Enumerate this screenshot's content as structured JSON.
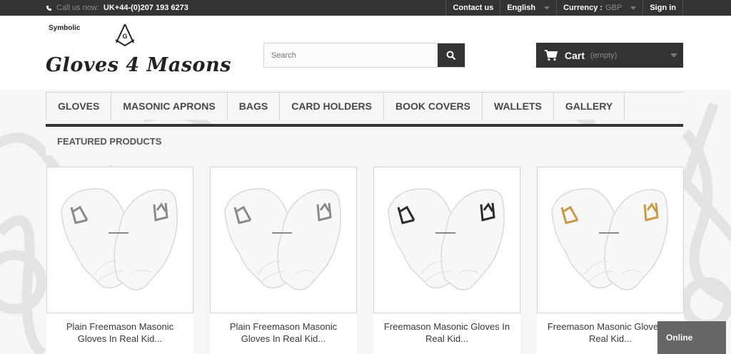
{
  "topbar": {
    "call_label": "Call us now:",
    "phone": "UK+44-(0)207 193 6273",
    "contact": "Contact us",
    "language": "English",
    "currency_label": "Currency :",
    "currency_value": "GBP",
    "signin": "Sign in"
  },
  "logo": {
    "subtitle": "Symbolic",
    "name": "Gloves 4 Masons"
  },
  "search": {
    "placeholder": "Search"
  },
  "cart": {
    "label": "Cart",
    "status": "(empty)"
  },
  "menu": {
    "items": [
      "GLOVES",
      "MASONIC APRONS",
      "BAGS",
      "CARD HOLDERS",
      "BOOK COVERS",
      "WALLETS",
      "GALLERY"
    ]
  },
  "featured": {
    "heading": "FEATURED PRODUCTS"
  },
  "products": [
    {
      "title": "Plain Freemason Masonic Gloves In Real Kid...",
      "emblem_color": "#8a8a8a"
    },
    {
      "title": "Plain Freemason Masonic Gloves In Real Kid...",
      "emblem_color": "#8a8a8a"
    },
    {
      "title": "Freemason Masonic Gloves In Real Kid...",
      "emblem_color": "#2b2b2b"
    },
    {
      "title": "Freemason Masonic Gloves In Real Kid...",
      "emblem_color": "#c99a45"
    }
  ],
  "chat": {
    "status": "Online"
  },
  "colors": {
    "dark": "#333333",
    "panel": "#f6f6f6"
  }
}
